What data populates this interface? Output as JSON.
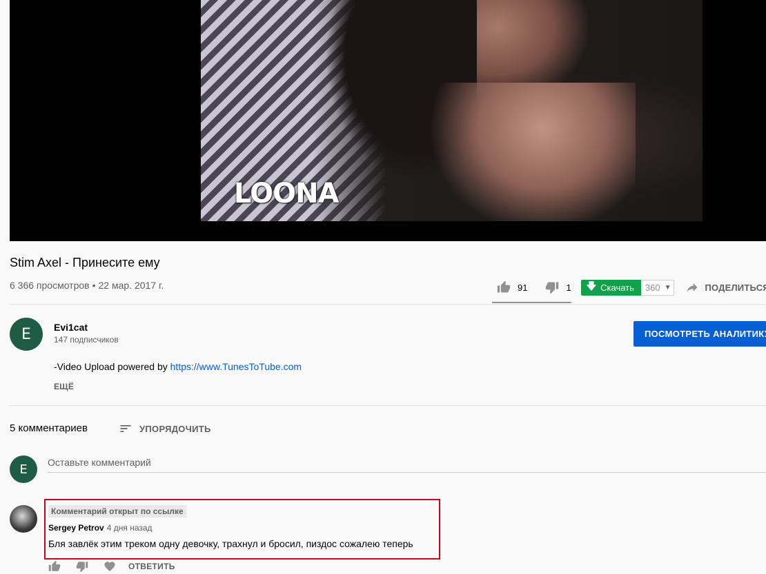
{
  "player": {
    "frame_text": "LOONA"
  },
  "video": {
    "title": "Stim Axel - Принесите ему",
    "views": "6 366 просмотров",
    "separator": "•",
    "date": "22 мар. 2017 г."
  },
  "actions": {
    "likes": "91",
    "dislikes": "1",
    "like_ratio": 0.98,
    "download_label": "Скачать",
    "download_quality": "360",
    "share_label": "ПОДЕЛИТЬСЯ"
  },
  "channel": {
    "avatar_letter": "E",
    "name": "Evi1cat",
    "subscribers": "147 подписчиков",
    "analytics_button": "ПОСМОТРЕТЬ АНАЛИТИКУ"
  },
  "description": {
    "text": "-Video Upload powered by ",
    "link": "https://www.TunesToTube.com",
    "more": "ЕЩЁ"
  },
  "comments": {
    "count_label": "5 комментариев",
    "sort_label": "УПОРЯДОЧИТЬ",
    "add_placeholder": "Оставьте комментарий",
    "user_avatar_letter": "E",
    "items": [
      {
        "badge": "Комментарий открыт по ссылке",
        "author": "Sergey Petrov",
        "time": "4 дня назад",
        "text": "Бля завлёк этим треком одну девочку, трахнул и бросил, пиздос сожалею теперь",
        "reply_label": "ОТВЕТИТЬ"
      }
    ]
  },
  "colors": {
    "accent_blue": "#065fd4",
    "download_green": "#12a14b",
    "highlight_red": "#d0021b",
    "avatar_green": "#1e5c46"
  }
}
